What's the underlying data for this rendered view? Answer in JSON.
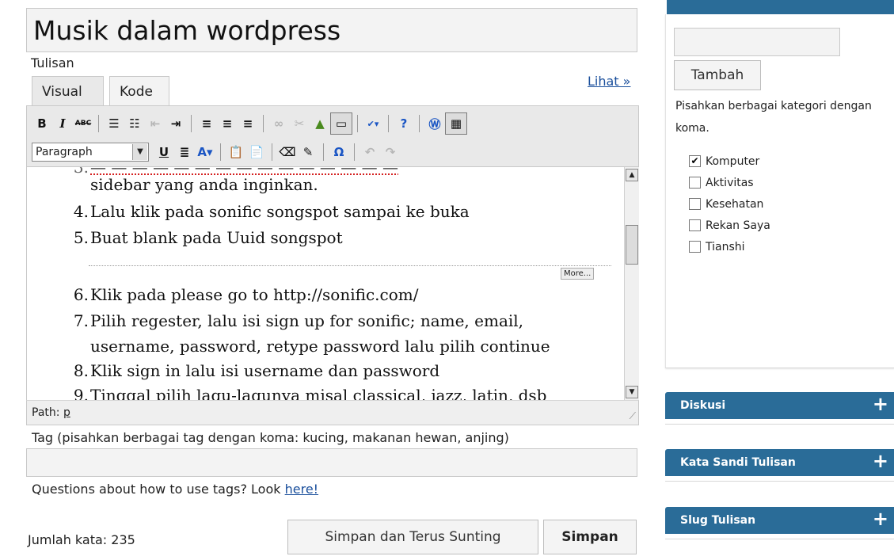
{
  "post": {
    "title": "Musik dalam wordpress",
    "section_label": "Tulisan"
  },
  "editor": {
    "tabs": [
      {
        "label": "Visual",
        "active": true
      },
      {
        "label": "Kode",
        "active": false
      }
    ],
    "preview_link": "Lihat »",
    "format_select": "Paragraph",
    "toolbar_row1": [
      "bold-icon",
      "italic-icon",
      "strikethrough-icon",
      "bullet-list-icon",
      "numbered-list-icon",
      "outdent-icon",
      "indent-icon",
      "align-left-icon",
      "align-center-icon",
      "align-right-icon",
      "link-icon",
      "unlink-icon",
      "insert-image-icon",
      "insert-more-icon",
      "spellcheck-icon",
      "help-icon",
      "wordpress-icon",
      "kitchen-sink-icon"
    ],
    "toolbar_row2": [
      "underline-icon",
      "justify-icon",
      "text-color-icon",
      "paste-text-icon",
      "paste-word-icon",
      "remove-format-icon",
      "cleanup-icon",
      "special-char-icon",
      "undo-icon",
      "redo-icon"
    ],
    "content_lines": [
      {
        "num": "",
        "text": "sidebar yang anda inginkan."
      },
      {
        "num": "4.",
        "text": "Lalu klik pada sonific songspot sampai ke buka"
      },
      {
        "num": "5.",
        "text": "Buat blank pada Uuid songspot"
      },
      {
        "num": "6.",
        "text": "Klik pada please go to http://sonific.com/"
      },
      {
        "num": "7.",
        "text": "Pilih regester, lalu isi sign up for sonific; name, email,"
      },
      {
        "num": "",
        "text": "username, password, retype password lalu pilih continue"
      },
      {
        "num": "8.",
        "text": "Klik sign in lalu isi username dan password"
      },
      {
        "num": "9.",
        "text": "Tinggal pilih lagu-lagunya misal classical, jazz, latin, dsb"
      }
    ],
    "more_label": "More...",
    "link_text": "http://sonific.com/",
    "path_label": "Path:",
    "path_value": "p"
  },
  "tags": {
    "label": "Tag (pisahkan berbagai tag dengan koma: kucing, makanan hewan, anjing)",
    "value": "",
    "help_text": "Questions about how to use tags? Look",
    "help_link": "here!"
  },
  "footer": {
    "word_count": "Jumlah kata: 235",
    "save_continue_label": "Simpan dan Terus Sunting",
    "save_label": "Simpan"
  },
  "sidebar": {
    "category_input_value": "",
    "add_button": "Tambah",
    "hint": "Pisahkan berbagai kategori dengan koma.",
    "categories": [
      {
        "label": "Komputer",
        "checked": true
      },
      {
        "label": "Aktivitas",
        "checked": false
      },
      {
        "label": "Kesehatan",
        "checked": false
      },
      {
        "label": "Rekan Saya",
        "checked": false
      },
      {
        "label": "Tianshi",
        "checked": false
      }
    ],
    "panels": [
      {
        "title": "Diskusi"
      },
      {
        "title": "Kata Sandi Tulisan"
      },
      {
        "title": "Slug Tulisan"
      }
    ],
    "panel_expand_symbol": "+"
  },
  "colors": {
    "panel_header": "#2a6c98",
    "link": "#1a4f9c",
    "spellcheck_underline": "#d42020"
  }
}
